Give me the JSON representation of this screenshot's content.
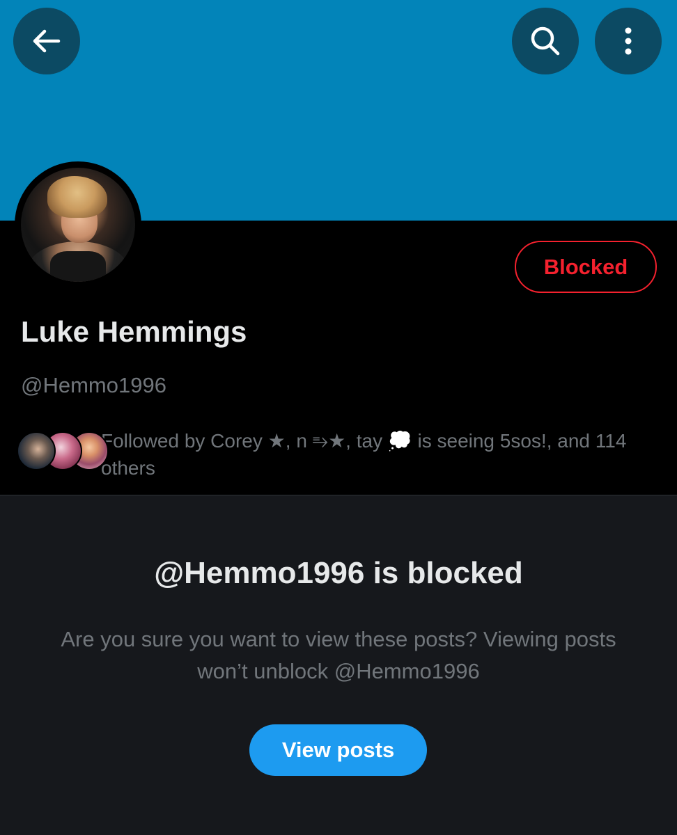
{
  "header": {
    "back_icon": "arrow-left-icon",
    "search_icon": "search-icon",
    "more_icon": "more-vertical-icon",
    "banner_color": "#0284b9"
  },
  "profile": {
    "display_name": "Luke Hemmings",
    "handle": "@Hemmo1996",
    "blocked_label": "Blocked",
    "followed_by_text": "Followed by Corey ★, n ⥱★, tay 💭 is seeing 5sos!, and 114 others"
  },
  "blocked_notice": {
    "title": "@Hemmo1996 is blocked",
    "description": "Are you sure you want to view these posts? Viewing posts won’t unblock @Hemmo1996",
    "button_label": "View posts"
  },
  "colors": {
    "accent": "#1d9bf0",
    "danger": "#f4212e",
    "panel_bg": "#16181c"
  }
}
